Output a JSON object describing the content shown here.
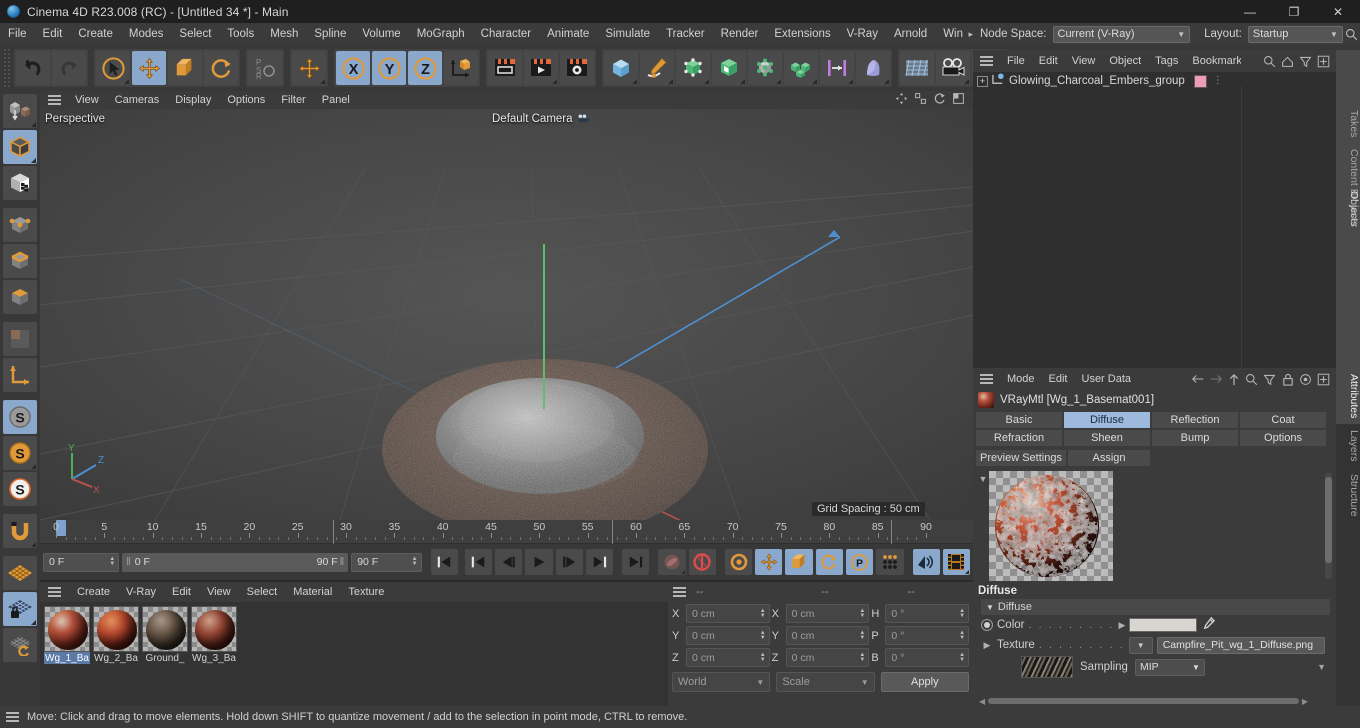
{
  "window": {
    "title": "Cinema 4D R23.008 (RC) - [Untitled 34 *] - Main",
    "logo": "c4d-logo",
    "minimize": "—",
    "maximize": "❐",
    "close": "✕"
  },
  "menubar": {
    "items": [
      "File",
      "Edit",
      "Create",
      "Modes",
      "Select",
      "Tools",
      "Mesh",
      "Spline",
      "Volume",
      "MoGraph",
      "Character",
      "Animate",
      "Simulate",
      "Tracker",
      "Render",
      "Extensions",
      "V-Ray",
      "Arnold",
      "Wind"
    ],
    "overflow_arrow": "▸",
    "node_space_label": "Node Space:",
    "node_space_value": "Current (V-Ray)",
    "layout_label": "Layout:",
    "layout_value": "Startup",
    "search_icon": "search-icon"
  },
  "toolbar": {
    "groups": [
      {
        "buttons": [
          {
            "name": "undo-button",
            "icon": "undo-icon",
            "active": false
          },
          {
            "name": "redo-button",
            "icon": "redo-icon",
            "active": false
          }
        ]
      },
      {
        "buttons": [
          {
            "name": "live-selection-tool",
            "icon": "cursor-circle-icon",
            "active": false
          },
          {
            "name": "move-tool",
            "icon": "move-arrows-icon",
            "active": true
          },
          {
            "name": "scale-tool",
            "icon": "scale-box-icon",
            "active": false
          },
          {
            "name": "rotate-tool",
            "icon": "rotate-arrows-icon",
            "active": false
          }
        ]
      },
      {
        "buttons": [
          {
            "name": "psr-lock-button",
            "icon": "psr-icon",
            "active": false
          }
        ]
      },
      {
        "buttons": [
          {
            "name": "world-object-axis-button",
            "icon": "move-arrows-icon",
            "active": false
          }
        ]
      },
      {
        "buttons": [
          {
            "name": "x-axis-lock",
            "icon": "x-axis-icon",
            "active": true
          },
          {
            "name": "y-axis-lock",
            "icon": "y-axis-icon",
            "active": true
          },
          {
            "name": "z-axis-lock",
            "icon": "z-axis-icon",
            "active": true
          },
          {
            "name": "world-coordinate-system",
            "icon": "axis-cube-icon",
            "active": false
          }
        ]
      },
      {
        "buttons": [
          {
            "name": "render-view-button",
            "icon": "render-view-icon",
            "active": false
          },
          {
            "name": "render-to-picture-viewer-button",
            "icon": "render-picture-icon",
            "active": false
          },
          {
            "name": "render-settings-button",
            "icon": "render-settings-icon",
            "active": false
          }
        ]
      },
      {
        "buttons": [
          {
            "name": "add-cube-object-button",
            "icon": "cube-blue-icon",
            "active": false
          },
          {
            "name": "add-spline-button",
            "icon": "pen-spline-icon",
            "active": false
          },
          {
            "name": "add-generator-button",
            "icon": "nurbs-green-icon",
            "active": false
          },
          {
            "name": "add-scene-object-button",
            "icon": "green-cube-icon",
            "active": false
          },
          {
            "name": "add-deformer-button",
            "icon": "deformer-icon",
            "active": false
          },
          {
            "name": "add-mograph-button",
            "icon": "cloner-icon",
            "active": false
          },
          {
            "name": "add-field-button",
            "icon": "field-icon",
            "active": false
          },
          {
            "name": "add-character-button",
            "icon": "character-icon",
            "active": false
          }
        ]
      },
      {
        "buttons": [
          {
            "name": "add-light-button",
            "icon": "grid-plane-icon",
            "active": false
          },
          {
            "name": "add-camera-button",
            "icon": "camera-icon",
            "active": false
          },
          {
            "name": "add-environment-button",
            "icon": "sphere-icon",
            "active": false
          }
        ]
      }
    ]
  },
  "left_toolbar": {
    "buttons": [
      {
        "name": "make-editable-button",
        "icon": "make-editable-icon",
        "active": false
      },
      {
        "name": "model-mode-button",
        "icon": "model-cube-icon",
        "active": true
      },
      {
        "name": "texture-mode-button",
        "icon": "texture-cube-icon",
        "active": false
      },
      {
        "name": "point-mode-button",
        "icon": "point-cube-icon",
        "active": false
      },
      {
        "name": "edge-mode-button",
        "icon": "edge-cube-icon",
        "active": false
      },
      {
        "name": "polygon-mode-button",
        "icon": "polygon-cube-icon",
        "active": false
      },
      {
        "name": "uv-mode-button",
        "icon": "uv-squares-icon",
        "active": false
      },
      {
        "name": "axis-mode-button",
        "icon": "axis-l-icon",
        "active": false
      },
      {
        "name": "enable-axis-modification-button",
        "icon": "s-grey-icon",
        "active": true
      },
      {
        "name": "viewport-solo-single-button",
        "icon": "s-orange-icon",
        "active": false
      },
      {
        "name": "viewport-solo-hierarchy-button",
        "icon": "s-white-icon",
        "active": false
      },
      {
        "name": "snap-button",
        "icon": "magnet-icon",
        "active": false
      },
      {
        "name": "workplane-button",
        "icon": "workplane-orange-icon",
        "active": false
      },
      {
        "name": "lock-workplane-button",
        "icon": "workplane-lock-icon",
        "active": true
      },
      {
        "name": "planar-workplane-button",
        "icon": "workplane-rotate-icon",
        "active": false
      }
    ]
  },
  "viewport": {
    "menus": [
      "View",
      "Cameras",
      "Display",
      "Options",
      "Filter",
      "Panel"
    ],
    "view_label": "Perspective",
    "camera_label": "Default Camera",
    "camera_icon": "camera-dots-icon",
    "grid_spacing": "Grid Spacing : 50 cm",
    "axis_gizmo": {
      "x": "X",
      "y": "Y",
      "z": "Z"
    },
    "scene_object": "Glowing charcoal embers pile on dirt disc"
  },
  "timeline": {
    "ticks": [
      0,
      5,
      10,
      15,
      20,
      25,
      30,
      35,
      40,
      45,
      50,
      55,
      60,
      65,
      70,
      75,
      80,
      85,
      90
    ],
    "current_frame": "0 F",
    "range_start": "0 F",
    "range_end": "90 F",
    "max_frame": "90 F",
    "preview_frame": "0 F",
    "controls": [
      {
        "name": "go-to-start-button",
        "icon": "skip-start-icon",
        "active": false
      },
      {
        "name": "go-to-previous-key-button",
        "icon": "prev-key-icon",
        "active": false
      },
      {
        "name": "go-to-previous-frame-button",
        "icon": "step-back-icon",
        "active": false
      },
      {
        "name": "play-button",
        "icon": "play-icon",
        "active": false
      },
      {
        "name": "go-to-next-frame-button",
        "icon": "step-forward-icon",
        "active": false
      },
      {
        "name": "go-to-next-key-button",
        "icon": "next-key-icon",
        "active": false
      },
      {
        "name": "go-to-end-button",
        "icon": "skip-end-icon",
        "active": false
      },
      {
        "name": "record-active-objects-button",
        "icon": "record-key-icon",
        "active": false
      },
      {
        "name": "autokeying-button",
        "icon": "autokey-icon",
        "active": false
      },
      {
        "name": "keyframe-selection-button",
        "icon": "keyframe-gear-icon",
        "active": false
      },
      {
        "name": "position-key-button",
        "icon": "move-arrows-icon",
        "active": true
      },
      {
        "name": "scale-key-button",
        "icon": "scale-box-icon",
        "active": true
      },
      {
        "name": "rotation-key-button",
        "icon": "rotate-arrows-icon",
        "active": true
      },
      {
        "name": "parameter-key-button",
        "icon": "p-circle-icon",
        "active": true
      },
      {
        "name": "point-level-animation-button",
        "icon": "pla-dots-icon",
        "active": false
      },
      {
        "name": "sound-button",
        "icon": "sound-icon",
        "active": true
      },
      {
        "name": "filmstrip-button",
        "icon": "filmstrip-icon",
        "active": true
      }
    ]
  },
  "material_manager": {
    "menus": [
      "Create",
      "V-Ray",
      "Edit",
      "View",
      "Select",
      "Material",
      "Texture"
    ],
    "materials": [
      {
        "name": "Wg_1_Ba",
        "selected": true,
        "swatch": "#b5503c"
      },
      {
        "name": "Wg_2_Ba",
        "selected": false,
        "swatch": "#a8452f"
      },
      {
        "name": "Ground_",
        "selected": false,
        "swatch": "#55483f"
      },
      {
        "name": "Wg_3_Ba",
        "selected": false,
        "swatch": "#9c4a38"
      }
    ]
  },
  "coordinate_manager": {
    "headers": [
      "--",
      "--",
      "--"
    ],
    "rows": [
      {
        "pos_label": "X",
        "pos_value": "0 cm",
        "size_label": "X",
        "size_value": "0 cm",
        "rot_label": "H",
        "rot_value": "0 °"
      },
      {
        "pos_label": "Y",
        "pos_value": "0 cm",
        "size_label": "Y",
        "size_value": "0 cm",
        "rot_label": "P",
        "rot_value": "0 °"
      },
      {
        "pos_label": "Z",
        "pos_value": "0 cm",
        "size_label": "Z",
        "size_value": "0 cm",
        "rot_label": "B",
        "rot_value": "0 °"
      }
    ],
    "system_value": "World",
    "mode_value": "Scale",
    "apply_label": "Apply"
  },
  "object_manager": {
    "menus": [
      "File",
      "Edit",
      "View",
      "Object",
      "Tags",
      "Bookmarks"
    ],
    "icons": [
      "search-icon",
      "home-icon",
      "filter-icon",
      "plus-icon"
    ],
    "objects": [
      {
        "name": "Glowing_Charcoal_Embers_group",
        "tag_color": "#ef9bbb",
        "expandable": "+"
      }
    ]
  },
  "attributes_manager": {
    "menus": [
      "Mode",
      "Edit",
      "User Data"
    ],
    "icons": [
      "back-arrow-icon",
      "forward-arrow-icon",
      "up-arrow-icon",
      "search-icon",
      "filter-icon",
      "lock-icon",
      "target-icon",
      "plus-icon"
    ],
    "title": "VRayMtl [Wg_1_Basemat001]",
    "tabs": [
      {
        "label": "Basic",
        "active": false
      },
      {
        "label": "Diffuse",
        "active": true
      },
      {
        "label": "Reflection",
        "active": false
      },
      {
        "label": "Coat",
        "active": false
      },
      {
        "label": "Refraction",
        "active": false
      },
      {
        "label": "Sheen",
        "active": false
      },
      {
        "label": "Bump",
        "active": false
      },
      {
        "label": "Options",
        "active": false
      }
    ],
    "buttons": [
      {
        "label": "Preview Settings"
      },
      {
        "label": "Assign"
      }
    ],
    "section_title": "Diffuse",
    "subsection_title": "Diffuse",
    "properties": {
      "color_label": "Color",
      "color_dots": ". . . . . . . . .",
      "color_value": "#d9d6d2",
      "color_picker_icon": "eyedropper-icon",
      "texture_label": "Texture",
      "texture_dots": ". . . . . . . . .",
      "texture_value": "Campfire_Pit_wg_1_Diffuse.png",
      "sampling_label": "Sampling",
      "sampling_value": "MIP"
    }
  },
  "vertical_tabs": {
    "top": [
      {
        "label": "Objects",
        "active": true
      },
      {
        "label": "Takes",
        "active": false
      },
      {
        "label": "Content Browser",
        "active": false
      }
    ],
    "bottom": [
      {
        "label": "Attributes",
        "active": true
      },
      {
        "label": "Layers",
        "active": false
      },
      {
        "label": "Structure",
        "active": false
      }
    ]
  },
  "statusbar": {
    "message": "Move: Click and drag to move elements. Hold down SHIFT to quantize movement / add to the selection in point mode, CTRL to remove."
  }
}
